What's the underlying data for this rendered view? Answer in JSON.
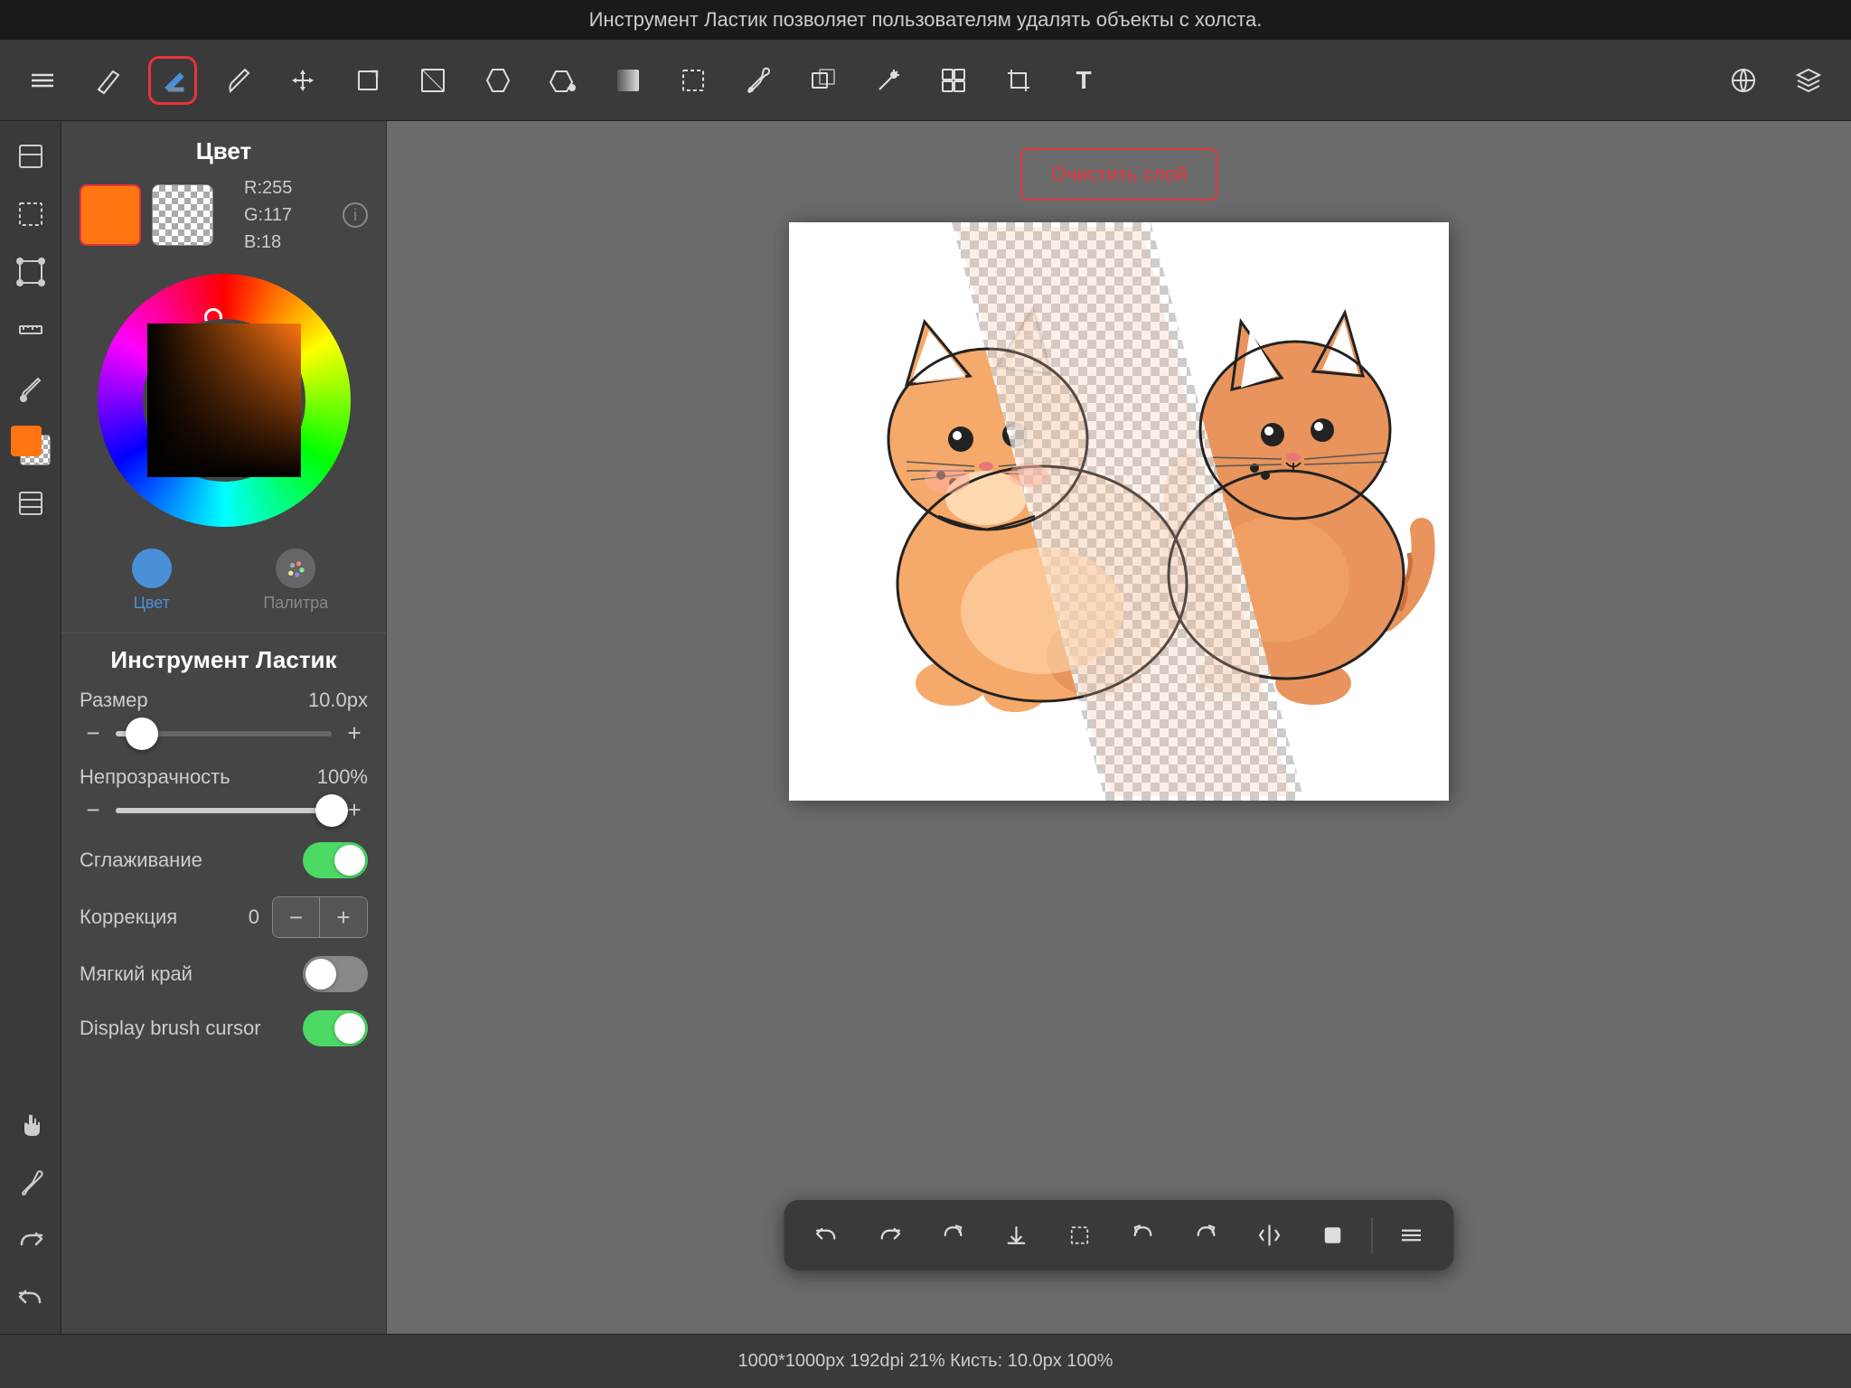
{
  "topbar": {
    "info_text": "Инструмент Ластик позволяет пользователям удалять объекты с холста."
  },
  "toolbar": {
    "tools": [
      {
        "name": "menu",
        "label": "☰"
      },
      {
        "name": "pencil",
        "label": "✏"
      },
      {
        "name": "eraser-active",
        "label": "◆"
      },
      {
        "name": "brush",
        "label": "✒"
      },
      {
        "name": "move",
        "label": "✛"
      },
      {
        "name": "transform",
        "label": "⬜"
      },
      {
        "name": "warp",
        "label": "⬚"
      },
      {
        "name": "fill",
        "label": "⬟"
      },
      {
        "name": "paint-bucket",
        "label": "⬡"
      },
      {
        "name": "gradient",
        "label": "▣"
      },
      {
        "name": "selection-rect",
        "label": "▢"
      },
      {
        "name": "eyedropper",
        "label": "💉"
      },
      {
        "name": "clone",
        "label": "⎘"
      },
      {
        "name": "magic-wand",
        "label": "◈"
      },
      {
        "name": "layer-group",
        "label": "⊞"
      },
      {
        "name": "crop",
        "label": "⌶"
      },
      {
        "name": "text",
        "label": "T"
      },
      {
        "name": "globe",
        "label": "🌐"
      },
      {
        "name": "layers",
        "label": "⊟"
      }
    ]
  },
  "panel": {
    "color_section": {
      "title": "Цвет",
      "primary_color": "#ff7512",
      "secondary_color": "transparent",
      "r": 255,
      "g": 117,
      "b": 18,
      "rgb_text": "R:255\nG:117\nB:18"
    },
    "color_tabs": [
      {
        "label": "Цвет",
        "active": true
      },
      {
        "label": "Палитра",
        "active": false
      }
    ],
    "tool_section": {
      "title": "Инструмент Ластик",
      "size_label": "Размер",
      "size_value": "10.0px",
      "size_percent": 12,
      "opacity_label": "Непрозрачность",
      "opacity_value": "100%",
      "opacity_percent": 100,
      "smoothing_label": "Сглаживание",
      "smoothing_on": true,
      "correction_label": "Коррекция",
      "correction_value": "0",
      "soft_edge_label": "Мягкий край",
      "soft_edge_on": false,
      "display_cursor_label": "Display brush cursor",
      "display_cursor_on": true
    }
  },
  "canvas": {
    "clear_layer_btn": "Очистить слой"
  },
  "status_bar": {
    "text": "1000*1000px 192dpi 21% Кисть: 10.0px 100%"
  },
  "bottom_toolbar": {
    "icons": [
      "↩",
      "↪",
      "↺",
      "⬇",
      "⬚",
      "↺",
      "↻",
      "⟲",
      "▣",
      "≡"
    ]
  }
}
